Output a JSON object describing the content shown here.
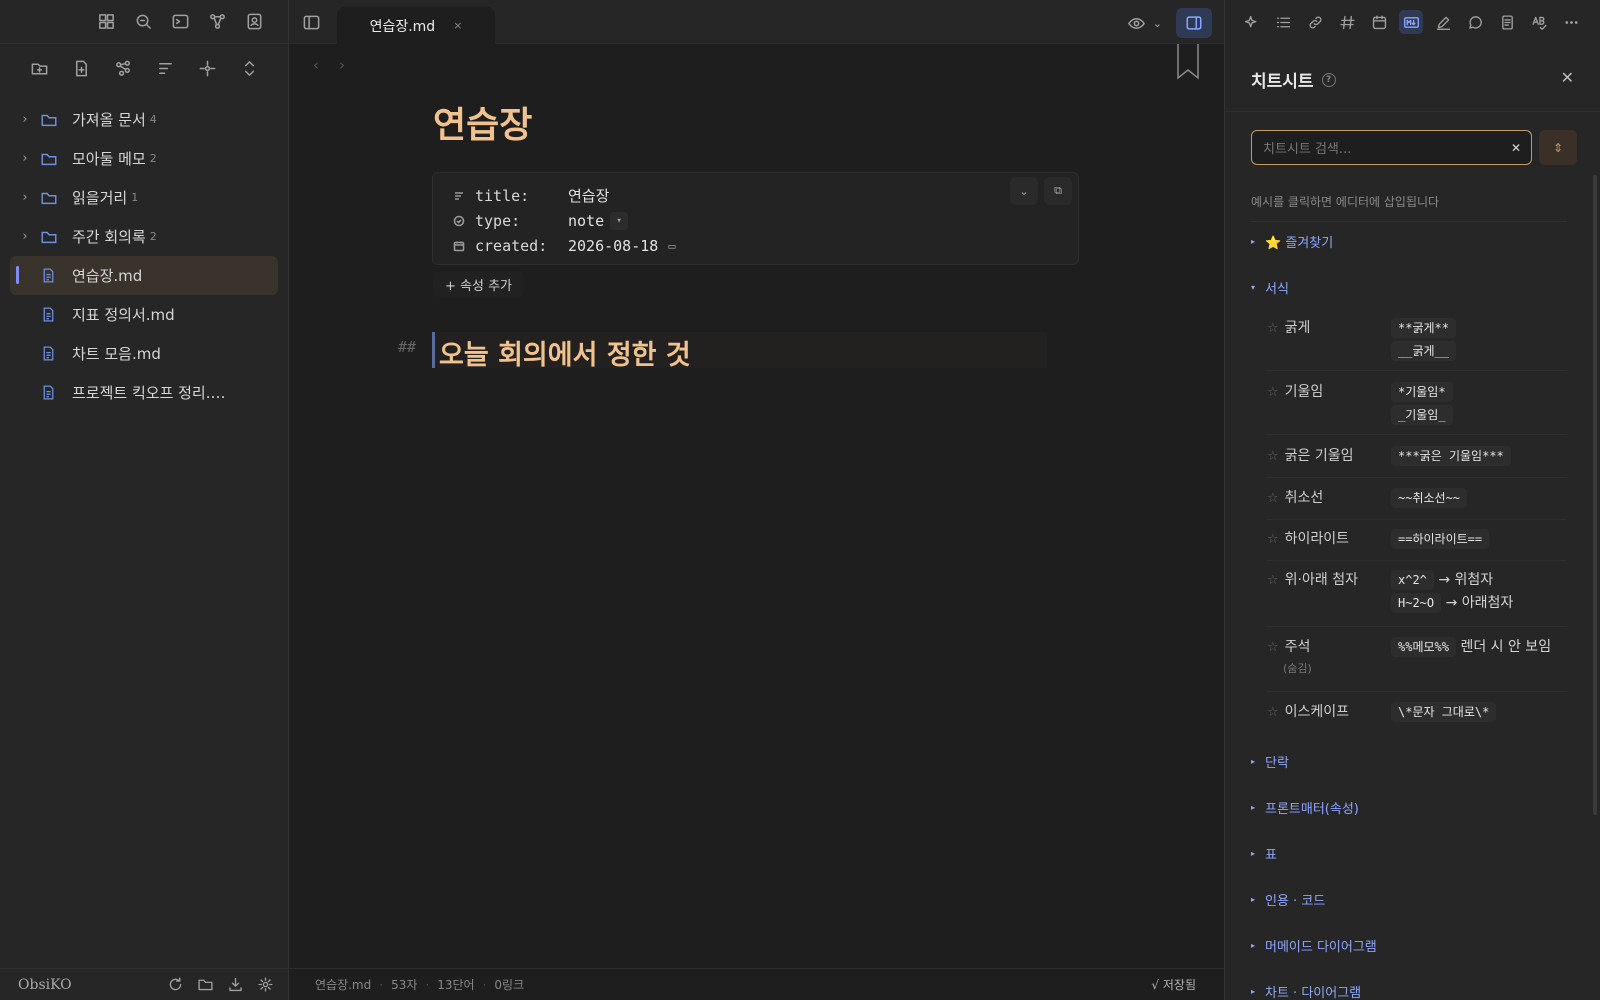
{
  "left_sidebar": {
    "tree": [
      {
        "type": "folder",
        "name": "가져올 문서",
        "count": "4"
      },
      {
        "type": "folder",
        "name": "모아둘 메모",
        "count": "2"
      },
      {
        "type": "folder",
        "name": "읽을거리",
        "count": "1"
      },
      {
        "type": "folder",
        "name": "주간 회의록",
        "count": "2"
      },
      {
        "type": "file",
        "name": "연습장.md",
        "active": true
      },
      {
        "type": "file",
        "name": "지표 정의서.md"
      },
      {
        "type": "file",
        "name": "차트 모음.md"
      },
      {
        "type": "file",
        "name": "프로젝트 킥오프 정리.…"
      }
    ],
    "vault_name": "ObsiKO"
  },
  "tab": {
    "title": "연습장.md",
    "close": "×"
  },
  "editor": {
    "title": "연습장",
    "properties": [
      {
        "key": "title:",
        "value": "연습장",
        "icon": "text-lines-icon"
      },
      {
        "key": "type:",
        "value": "note",
        "icon": "circle-check-icon"
      },
      {
        "key": "created:",
        "value": "2026-08-18",
        "icon": "calendar-icon"
      }
    ],
    "add_property": "+ 속성 추가",
    "heading_marker": "##",
    "heading": "오늘 회의에서 정한 것"
  },
  "statusbar": {
    "file": "연습장.md",
    "chars": "53자",
    "words": "13단어",
    "links": "0링크",
    "saved": "√ 저장됨"
  },
  "cheatsheet": {
    "title": "치트시트",
    "help": "?",
    "close": "✕",
    "search_placeholder": "치트시트 검색...",
    "search_clear": "✕",
    "hint": "예시를 클릭하면 에디터에 삽입됩니다",
    "favorites": "⭐ 즐겨찾기",
    "format_section": "서식",
    "rows": [
      {
        "label": "굵게",
        "examples": [
          "**굵게**",
          "__굵게__"
        ]
      },
      {
        "label": "기울임",
        "examples": [
          "*기울임*",
          "_기울임_"
        ]
      },
      {
        "label": "굵은 기울임",
        "examples": [
          "***굵은 기울임***"
        ]
      },
      {
        "label": "취소선",
        "examples": [
          "~~취소선~~"
        ]
      },
      {
        "label": "하이라이트",
        "examples": [
          "==하이라이트=="
        ]
      },
      {
        "label": "위·아래 첨자",
        "code1": "x^2^",
        "desc1": "→ 위첨자",
        "code2": "H~2~O",
        "desc2": "→ 아래첨자"
      },
      {
        "label": "주석",
        "sublabel": "(숨김)",
        "code1": "%%메모%%",
        "desc1": "렌더 시 안 보임"
      },
      {
        "label": "이스케이프",
        "examples": [
          "\\*문자 그대로\\*"
        ]
      }
    ],
    "collapsed_sections": [
      "단락",
      "프론트매터(속성)",
      "표",
      "인용 · 코드",
      "머메이드 다이어그램",
      "차트 · 다이어그램"
    ]
  }
}
